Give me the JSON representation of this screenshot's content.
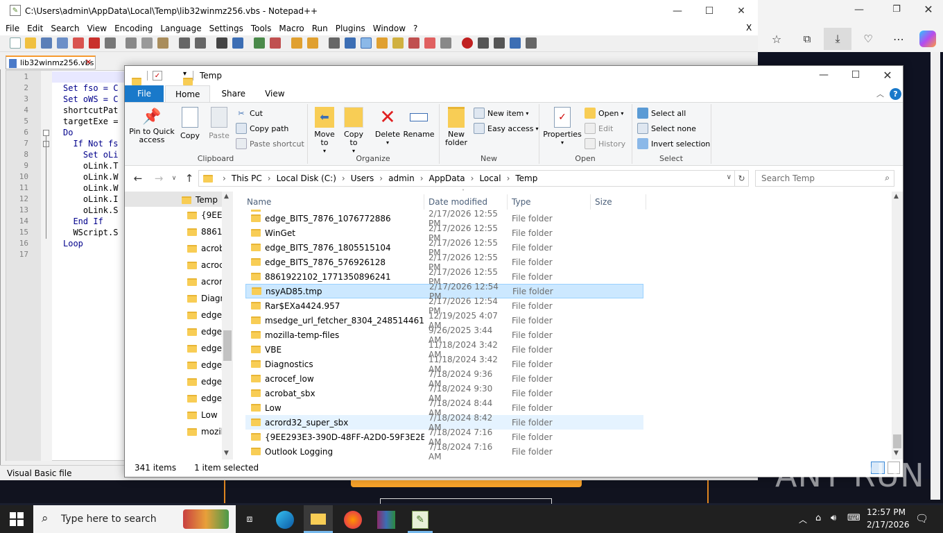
{
  "notepad": {
    "title": "C:\\Users\\admin\\AppData\\Local\\Temp\\lib32winmz256.vbs - Notepad++",
    "menu": [
      "File",
      "Edit",
      "Search",
      "View",
      "Encoding",
      "Language",
      "Settings",
      "Tools",
      "Macro",
      "Run",
      "Plugins",
      "Window",
      "?"
    ],
    "menu_close": "X",
    "tab": "lib32winmz256.vbs",
    "tab_close": "✕",
    "status": "Visual Basic file",
    "lines": [
      {
        "n": "1",
        "text": ""
      },
      {
        "n": "2",
        "text": "Set fso = C"
      },
      {
        "n": "3",
        "text": "Set oWS = C"
      },
      {
        "n": "4",
        "text": "shortcutPat"
      },
      {
        "n": "5",
        "text": "targetExe ="
      },
      {
        "n": "6",
        "text": "Do"
      },
      {
        "n": "7",
        "text": "  If Not fs"
      },
      {
        "n": "8",
        "text": "    Set oLi"
      },
      {
        "n": "9",
        "text": "    oLink.T"
      },
      {
        "n": "10",
        "text": "    oLink.W"
      },
      {
        "n": "11",
        "text": "    oLink.W"
      },
      {
        "n": "12",
        "text": "    oLink.I"
      },
      {
        "n": "13",
        "text": "    oLink.S"
      },
      {
        "n": "14",
        "text": "  End If"
      },
      {
        "n": "15",
        "text": "  WScript.S"
      },
      {
        "n": "16",
        "text": "Loop"
      },
      {
        "n": "17",
        "text": ""
      }
    ]
  },
  "explorer": {
    "title": "Temp",
    "tabs": [
      "File",
      "Home",
      "Share",
      "View"
    ],
    "ribbon": {
      "clipboard": {
        "pin": "Pin to Quick access",
        "copy": "Copy",
        "paste": "Paste",
        "cut": "Cut",
        "copy_path": "Copy path",
        "paste_shortcut": "Paste shortcut",
        "label": "Clipboard"
      },
      "organize": {
        "move": "Move to",
        "copy": "Copy to",
        "delete": "Delete",
        "rename": "Rename",
        "label": "Organize"
      },
      "new": {
        "folder": "New folder",
        "item": "New item",
        "easy": "Easy access",
        "label": "New"
      },
      "open": {
        "properties": "Properties",
        "open": "Open",
        "edit": "Edit",
        "history": "History",
        "label": "Open"
      },
      "select": {
        "all": "Select all",
        "none": "Select none",
        "invert": "Invert selection",
        "label": "Select"
      }
    },
    "breadcrumb": [
      "This PC",
      "Local Disk (C:)",
      "Users",
      "admin",
      "AppData",
      "Local",
      "Temp"
    ],
    "breadcrumb_sep": "›",
    "search_placeholder": "Search Temp",
    "nav": [
      "Temp",
      "{9EE29",
      "88619",
      "acrob",
      "acroc",
      "acrord",
      "Diagn",
      "edge_",
      "edge_",
      "edge_",
      "edge_",
      "edge_",
      "edge_",
      "Low",
      "mozil"
    ],
    "columns": {
      "name": "Name",
      "date": "Date modified",
      "type": "Type",
      "size": "Size"
    },
    "files": [
      {
        "name": "edge_BITS_7876_1076772886",
        "date": "2/17/2026 12:55 PM",
        "type": "File folder"
      },
      {
        "name": "WinGet",
        "date": "2/17/2026 12:55 PM",
        "type": "File folder"
      },
      {
        "name": "edge_BITS_7876_1805515104",
        "date": "2/17/2026 12:55 PM",
        "type": "File folder"
      },
      {
        "name": "edge_BITS_7876_576926128",
        "date": "2/17/2026 12:55 PM",
        "type": "File folder"
      },
      {
        "name": "8861922102_1771350896241",
        "date": "2/17/2026 12:55 PM",
        "type": "File folder"
      },
      {
        "name": "nsyAD85.tmp",
        "date": "2/17/2026 12:54 PM",
        "type": "File folder"
      },
      {
        "name": "Rar$EXa4424.957",
        "date": "2/17/2026 12:54 PM",
        "type": "File folder"
      },
      {
        "name": "msedge_url_fetcher_8304_248514461",
        "date": "12/19/2025 4:07 AM",
        "type": "File folder"
      },
      {
        "name": "mozilla-temp-files",
        "date": "9/26/2025 3:44 AM",
        "type": "File folder"
      },
      {
        "name": "VBE",
        "date": "11/18/2024 3:42 AM",
        "type": "File folder"
      },
      {
        "name": "Diagnostics",
        "date": "11/18/2024 3:42 AM",
        "type": "File folder"
      },
      {
        "name": "acrocef_low",
        "date": "7/18/2024 9:36 AM",
        "type": "File folder"
      },
      {
        "name": "acrobat_sbx",
        "date": "7/18/2024 9:30 AM",
        "type": "File folder"
      },
      {
        "name": "Low",
        "date": "7/18/2024 8:44 AM",
        "type": "File folder"
      },
      {
        "name": "acrord32_super_sbx",
        "date": "7/18/2024 8:42 AM",
        "type": "File folder"
      },
      {
        "name": "{9EE293E3-390D-48FF-A2D0-59F3E2EC88...",
        "date": "7/18/2024 7:16 AM",
        "type": "File folder"
      },
      {
        "name": "Outlook Logging",
        "date": "7/18/2024 7:16 AM",
        "type": "File folder"
      }
    ],
    "status_items": "341 items",
    "status_selected": "1 item selected"
  },
  "taskbar": {
    "search": "Type here to search",
    "time": "12:57 PM",
    "date": "2/17/2026"
  },
  "watermark": "ANY RUN",
  "colors": {
    "accent": "#0078d7",
    "selection": "#cce8ff",
    "folder": "#f8cd55",
    "npp_tab": "#f79a2e"
  }
}
